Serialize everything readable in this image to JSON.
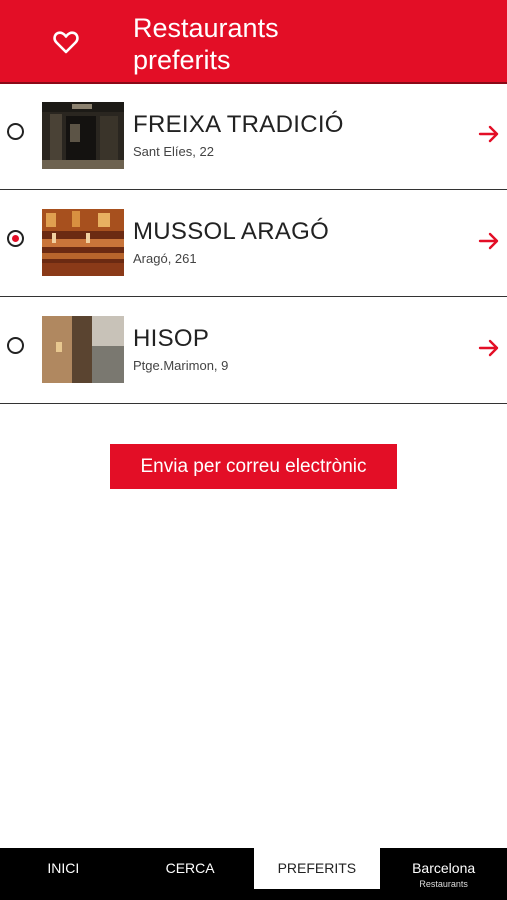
{
  "header": {
    "title_line1": "Restaurants",
    "title_line2": "preferits",
    "icon": "heart-icon"
  },
  "restaurants": [
    {
      "name": "FREIXA TRADICIÓ",
      "address": "Sant Elíes, 22",
      "selected": false
    },
    {
      "name": "MUSSOL ARAGÓ",
      "address": "Aragó, 261",
      "selected": true
    },
    {
      "name": "HISOP",
      "address": "Ptge.Marimon, 9",
      "selected": false
    }
  ],
  "actions": {
    "send_label": "Envia per correu electrònic"
  },
  "tabs": [
    {
      "label": "INICI"
    },
    {
      "label": "CERCA"
    },
    {
      "label": "PREFERITS",
      "active": true
    },
    {
      "label": "Barcelona",
      "sub": "Restaurants"
    }
  ],
  "colors": {
    "accent": "#e30e26",
    "tabbar": "#000000"
  }
}
